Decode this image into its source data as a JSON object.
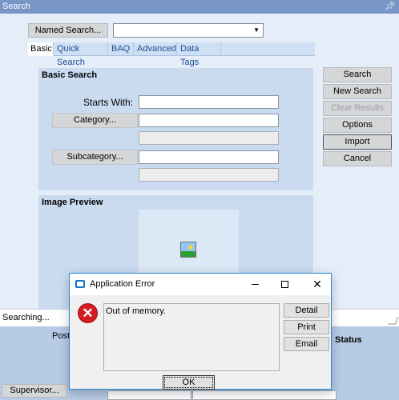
{
  "window": {
    "title": "Search",
    "pin_icon": "pin-icon"
  },
  "named_search": {
    "button_label": "Named Search...",
    "select_value": ""
  },
  "tabs": [
    {
      "label": "Basic"
    },
    {
      "label": "Quick Search"
    },
    {
      "label": "BAQ"
    },
    {
      "label": "Advanced"
    },
    {
      "label": "Data Tags"
    }
  ],
  "basic_search": {
    "title": "Basic Search",
    "starts_with_label": "Starts With:",
    "starts_with_value": "",
    "category_button": "Category...",
    "category_value": "",
    "category_desc": "",
    "subcategory_button": "Subcategory...",
    "subcategory_value": "",
    "subcategory_desc": ""
  },
  "image_preview": {
    "title": "Image Preview",
    "icon": "image-icon"
  },
  "side_buttons": {
    "search": "Search",
    "new_search": "New Search",
    "clear_results": "Clear Results",
    "options": "Options",
    "import": "Import",
    "cancel": "Cancel"
  },
  "status": {
    "text": "Searching..."
  },
  "background": {
    "post_label": "Post",
    "status_label": "Status",
    "supervisor_button": "Supervisor..."
  },
  "dialog": {
    "title": "Application Error",
    "message": "Out of memory.",
    "detail_button": "Detail",
    "print_button": "Print",
    "email_button": "Email",
    "ok_button": "OK",
    "minimize": "",
    "maximize": "",
    "close": "✕"
  },
  "colors": {
    "titlebar": "#7895c7",
    "panel": "#cadbf0",
    "error_red": "#d51c21",
    "dialog_border": "#1f88d6"
  }
}
